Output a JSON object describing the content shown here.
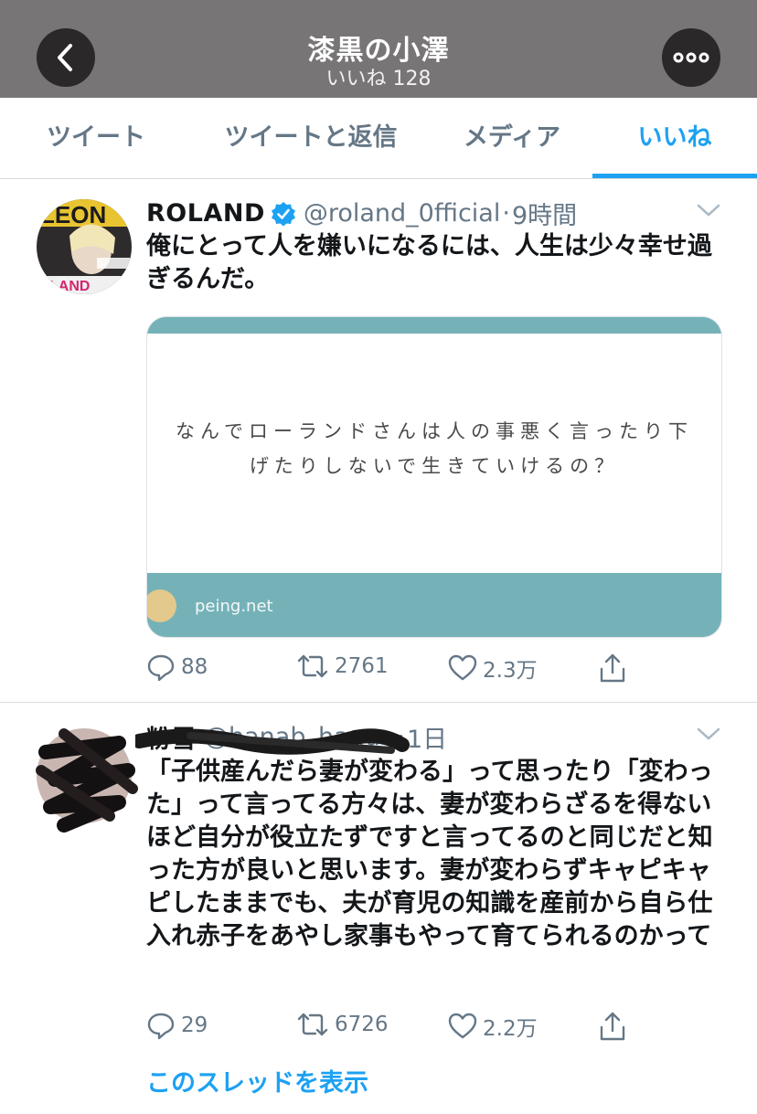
{
  "header": {
    "title": "漆黒の小澤",
    "subtitle": "いいね 128"
  },
  "tabs": [
    {
      "label": "ツイート"
    },
    {
      "label": "ツイートと返信"
    },
    {
      "label": "メディア"
    },
    {
      "label": "いいね"
    }
  ],
  "tweets": [
    {
      "name": "ROLAND",
      "verified": true,
      "handle": "@roland_0fficial",
      "sep": "·",
      "time": "9時間",
      "text": "俺にとって人を嫌いになるには、人生は少々幸せ過ぎるんだ。",
      "card": {
        "text": "なんでローランドさんは人の事悪く言ったり下げたりしないで生きていけるの？",
        "domain": "peing.net"
      },
      "replies": "88",
      "retweets": "2761",
      "likes": "2.3万"
    },
    {
      "name": "粉雪",
      "handle": "@hanab_hanuo",
      "sep": "·",
      "time": "1日",
      "text": "「子供産んだら妻が変わる」って思ったり「変わった」って言ってる方々は、妻が変わらざるを得ないほど自分が役立たずですと言ってるのと同じだと知った方が良いと思います。妻が変わらずキャピキャピしたままでも、夫が育児の知識を産前から自ら仕入れ赤子をあやし家事もやって育てられるのかって",
      "replies": "29",
      "retweets": "6726",
      "likes": "2.2万",
      "thread_link": "このスレッドを表示"
    }
  ],
  "colors": {
    "accent": "#1da1f2",
    "header_bg": "#787576",
    "muted": "#657786",
    "card_teal": "#74b2b8"
  }
}
